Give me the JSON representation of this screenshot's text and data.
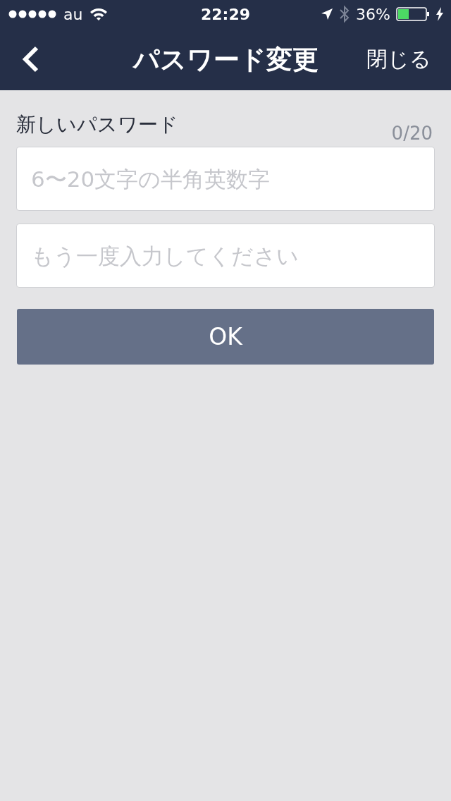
{
  "status_bar": {
    "carrier": "au",
    "time": "22:29",
    "battery": "36%"
  },
  "nav": {
    "title": "パスワード変更",
    "close": "閉じる"
  },
  "form": {
    "label": "新しいパスワード",
    "counter": "0/20",
    "fields": [
      {
        "placeholder": "6〜20文字の半角英数字"
      },
      {
        "placeholder": "もう一度入力してください"
      }
    ],
    "button": "OK"
  }
}
